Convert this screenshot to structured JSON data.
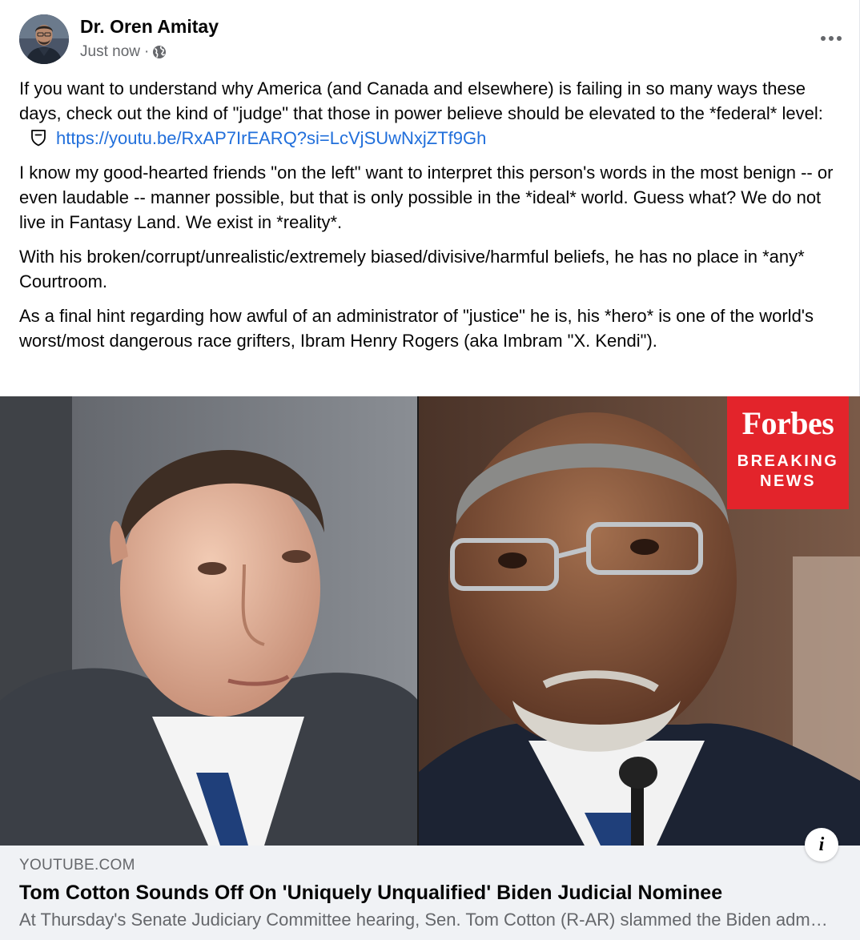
{
  "post": {
    "author": "Dr. Oren Amitay",
    "timestamp": "Just now",
    "separator": "·",
    "audience_icon": "globe-icon",
    "more_icon": "more-options-icon",
    "body": {
      "p1_text": "If you want to understand why America (and Canada and elsewhere) is failing in so many ways these days, check out the kind of \"judge\" that those in power believe should be elevated to the *federal* level:",
      "p1_link": "https://youtu.be/RxAP7IrEARQ?si=LcVjSUwNxjZTf9Gh",
      "p2": "I know my good-hearted friends \"on the left\" want to interpret this person's words in the most benign -- or even laudable -- manner possible, but that is only possible in the *ideal* world. Guess what? We do not live in Fantasy Land. We exist in *reality*.",
      "p3": "With his broken/corrupt/unrealistic/extremely biased/divisive/harmful beliefs, he has no place in *any* Courtroom.",
      "p4": "As a final hint regarding how awful of an administrator of \"justice\" he is, his *hero* is one of the world's worst/most dangerous race grifters, Ibram Henry Rogers (aka Imbram \"X. Kendi\")."
    }
  },
  "preview": {
    "badge_logo": "Forbes",
    "badge_line1": "BREAKING",
    "badge_line2": "NEWS",
    "info_label": "i",
    "colors": {
      "badge_red": "#e3242b"
    }
  },
  "link_card": {
    "domain": "YOUTUBE.COM",
    "title": "Tom Cotton Sounds Off On 'Uniquely Unqualified' Biden Judicial Nominee",
    "description": "At Thursday's Senate Judiciary Committee hearing, Sen. Tom Cotton (R-AR) slammed the Biden administration's judicial nominee"
  },
  "colors": {
    "link": "#216fdb",
    "secondary_text": "#65676b",
    "card_bg": "#f0f2f5"
  }
}
